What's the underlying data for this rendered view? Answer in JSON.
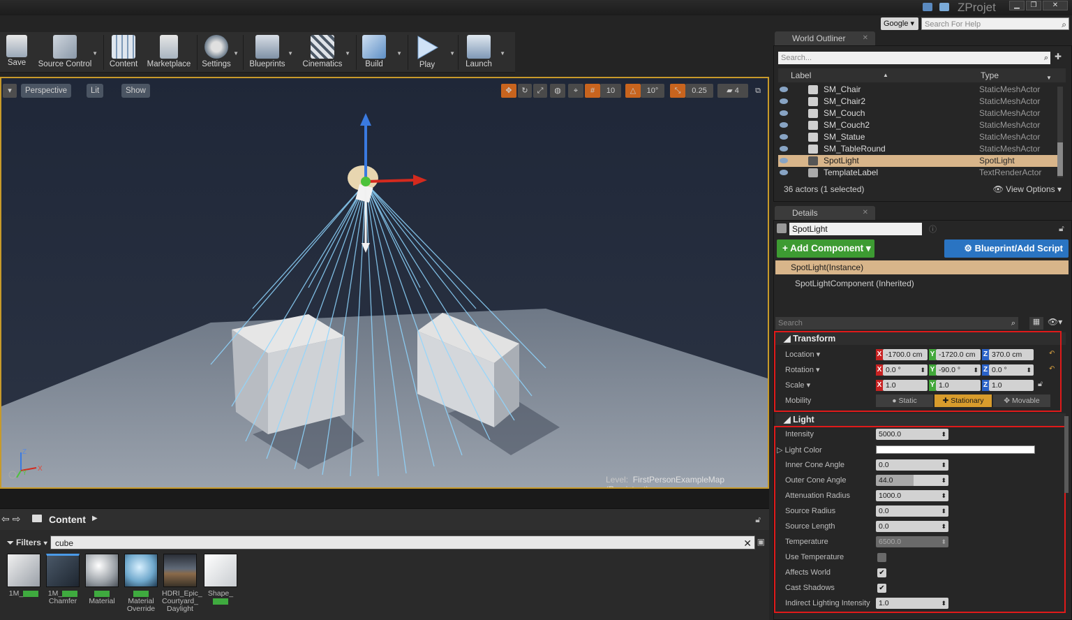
{
  "titlebar": {
    "project": "ZProjet",
    "win_min": "▁",
    "win_max": "❐",
    "win_close": "✕"
  },
  "help": {
    "engine": "Google",
    "placeholder": "Search For Help"
  },
  "toolbar": {
    "items": [
      {
        "label": "Save"
      },
      {
        "label": "Source Control"
      },
      {
        "label": "Content"
      },
      {
        "label": "Marketplace"
      },
      {
        "label": "Settings"
      },
      {
        "label": "Blueprints"
      },
      {
        "label": "Cinematics"
      },
      {
        "label": "Build"
      },
      {
        "label": "Play"
      },
      {
        "label": "Launch"
      }
    ]
  },
  "viewport": {
    "perspective": "Perspective",
    "lit": "Lit",
    "show": "Show",
    "grid_snap": "10",
    "rot_snap": "10°",
    "scale_snap": "0.25",
    "cam_speed": "4",
    "level_prefix": "Level:",
    "level_name": "FirstPersonExampleMap (Persistent)",
    "axis_x": "X",
    "axis_y": "Y",
    "axis_z": "Z"
  },
  "content_browser": {
    "title": "Content",
    "filters": "Filters",
    "search_value": "cube",
    "assets": [
      {
        "line1": "1M_",
        "line2": ""
      },
      {
        "line1": "1M_",
        "line2": "Chamfer"
      },
      {
        "line1": "",
        "line2": "Material"
      },
      {
        "line1": "Material",
        "line2": "Override"
      },
      {
        "line1": "HDRI_Epic_",
        "line2": "Courtyard_",
        "line3": "Daylight"
      },
      {
        "line1": "Shape_",
        "line2": ""
      }
    ]
  },
  "outliner": {
    "tab": "World Outliner",
    "search_placeholder": "Search...",
    "col_label": "Label",
    "col_type": "Type",
    "rows": [
      {
        "label": "SM_Chair",
        "type": "StaticMeshActor"
      },
      {
        "label": "SM_Chair2",
        "type": "StaticMeshActor"
      },
      {
        "label": "SM_Couch",
        "type": "StaticMeshActor"
      },
      {
        "label": "SM_Couch2",
        "type": "StaticMeshActor"
      },
      {
        "label": "SM_Statue",
        "type": "StaticMeshActor"
      },
      {
        "label": "SM_TableRound",
        "type": "StaticMeshActor"
      },
      {
        "label": "SpotLight",
        "type": "SpotLight"
      },
      {
        "label": "TemplateLabel",
        "type": "TextRenderActor"
      }
    ],
    "footer": "36 actors (1 selected)",
    "view_options": "View Options"
  },
  "details": {
    "tab": "Details",
    "actor_name": "SpotLight",
    "add_component": "+ Add Component",
    "blueprint_script": "Blueprint/Add Script",
    "component_instance": "SpotLight(Instance)",
    "component_inherited": "SpotLightComponent (Inherited)",
    "search_placeholder": "Search",
    "transform": {
      "title": "Transform",
      "location_label": "Location",
      "rotation_label": "Rotation",
      "scale_label": "Scale",
      "mobility_label": "Mobility",
      "location": {
        "x": "-1700.0 cm",
        "y": "-1720.0 cm",
        "z": "370.0 cm"
      },
      "rotation": {
        "x": "0.0 °",
        "y": "-90.0 °",
        "z": "0.0 °"
      },
      "scale": {
        "x": "1.0",
        "y": "1.0",
        "z": "1.0"
      },
      "mobility_options": [
        "Static",
        "Stationary",
        "Movable"
      ],
      "mobility_selected": "Stationary"
    },
    "light": {
      "title": "Light",
      "intensity_label": "Intensity",
      "intensity": "5000.0",
      "light_color_label": "Light Color",
      "light_color": "#ffffff",
      "inner_cone_label": "Inner Cone Angle",
      "inner_cone": "0.0",
      "outer_cone_label": "Outer Cone Angle",
      "outer_cone": "44.0",
      "atten_label": "Attenuation Radius",
      "atten": "1000.0",
      "source_radius_label": "Source Radius",
      "source_radius": "0.0",
      "source_length_label": "Source Length",
      "source_length": "0.0",
      "temperature_label": "Temperature",
      "temperature": "6500.0",
      "use_temp_label": "Use Temperature",
      "use_temp": false,
      "affects_world_label": "Affects World",
      "affects_world": true,
      "cast_shadows_label": "Cast Shadows",
      "cast_shadows": true,
      "indirect_label": "Indirect Lighting Intensity",
      "indirect": "1.0"
    }
  },
  "colors": {
    "selection": "#d8b58a",
    "highlight_box": "#e01a1a",
    "viewport_border": "#c79a2a",
    "add_component": "#3d9b32",
    "blueprint": "#2a74c2"
  }
}
